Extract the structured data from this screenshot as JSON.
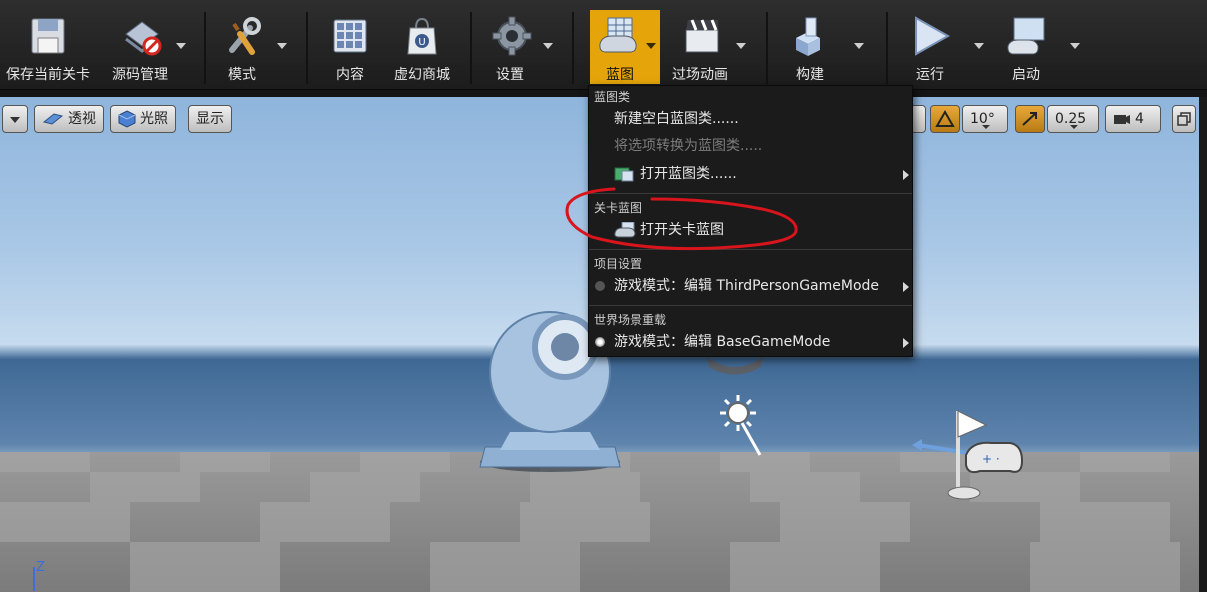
{
  "toolbar": {
    "buttons": [
      {
        "label": "保存当前关卡"
      },
      {
        "label": "源码管理"
      },
      {
        "label": "模式"
      },
      {
        "label": "内容"
      },
      {
        "label": "虚幻商城"
      },
      {
        "label": "设置"
      },
      {
        "label": "蓝图"
      },
      {
        "label": "过场动画"
      },
      {
        "label": "构建"
      },
      {
        "label": "运行"
      },
      {
        "label": "启动"
      }
    ]
  },
  "viewport": {
    "perspective_label": "透视",
    "lighting_label": "光照",
    "show_label": "显示",
    "rotation_snap": "10°",
    "scale_snap": "0.25",
    "camera_speed": "4",
    "axis_label": "Z"
  },
  "menu": {
    "section_blueprint": "蓝图类",
    "new_empty_blueprint": "新建空白蓝图类......",
    "convert_selection": "将选项转换为蓝图类.....",
    "open_blueprint_class": "打开蓝图类......",
    "section_level": "关卡蓝图",
    "open_level_blueprint": "打开关卡蓝图",
    "section_project": "项目设置",
    "project_game_mode": "游戏模式：编辑 ThirdPersonGameMode",
    "section_world": "世界场景重载",
    "world_game_mode": "游戏模式：编辑 BaseGameMode"
  },
  "colors": {
    "active_tab": "#e5a40a",
    "annotation": "#d8141c"
  }
}
